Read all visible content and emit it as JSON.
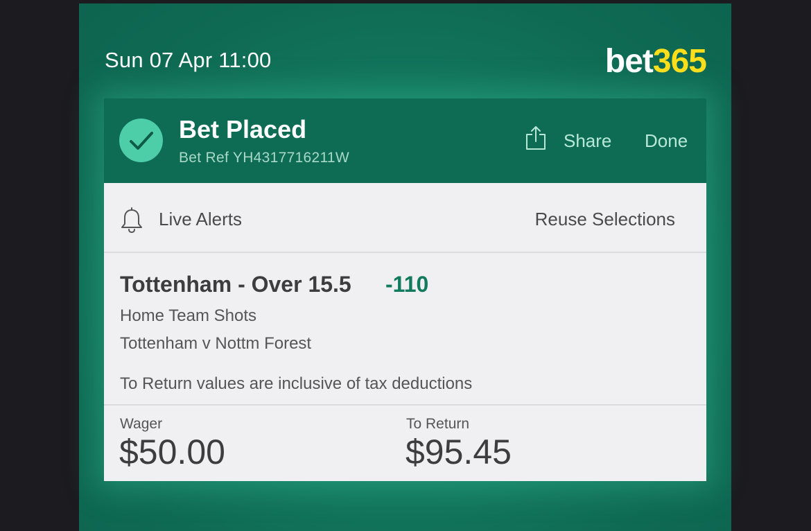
{
  "status": {
    "datetime": "Sun 07 Apr 11:00"
  },
  "brand": {
    "logo_text_bet": "bet",
    "logo_text_num": "365",
    "primary_color": "#0e6c55",
    "accent_color": "#ffdf1b"
  },
  "header": {
    "title": "Bet Placed",
    "bet_ref": "Bet Ref YH4317716211W",
    "share_label": "Share",
    "done_label": "Done",
    "check_icon": "checkmark-icon",
    "share_icon": "share-icon"
  },
  "alerts": {
    "live_alerts_label": "Live Alerts",
    "reuse_label": "Reuse Selections",
    "bell_icon": "bell-icon"
  },
  "selection": {
    "title": "Tottenham - Over 15.5",
    "odds": "-110",
    "market": "Home Team Shots",
    "fixture": "Tottenham v Nottm Forest",
    "tax_note": "To Return values are inclusive of tax deductions"
  },
  "totals": {
    "wager_label": "Wager",
    "wager_value": "$50.00",
    "return_label": "To Return",
    "return_value": "$95.45"
  }
}
